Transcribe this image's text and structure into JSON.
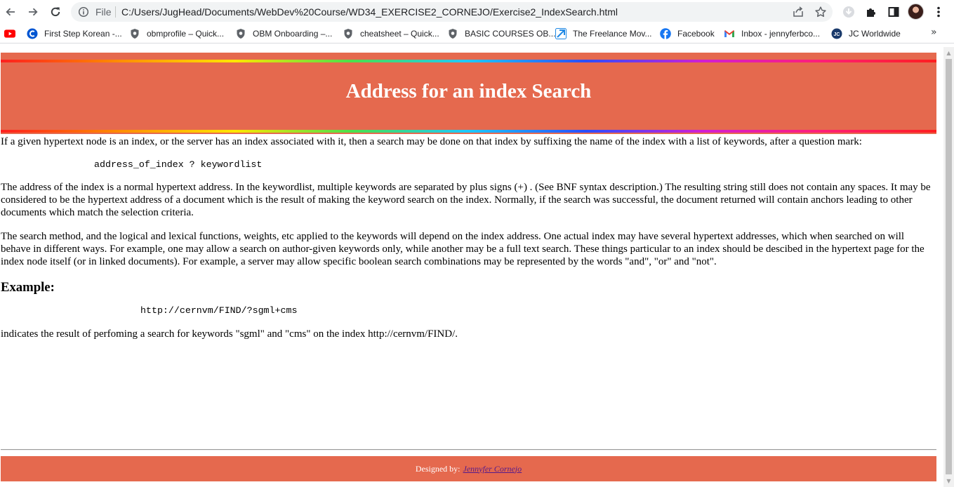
{
  "browser": {
    "omnibox": {
      "scheme_label": "File",
      "url": "C:/Users/JugHead/Documents/WebDev%20Course/WD34_EXERCISE2_CORNEJO/Exercise2_IndexSearch.html"
    },
    "icons": {
      "back": "back-arrow-icon",
      "forward": "forward-arrow-icon",
      "reload": "reload-icon",
      "info": "info-icon",
      "share": "share-icon",
      "bookmark": "star-icon",
      "download": "download-icon",
      "extensions": "puzzle-icon",
      "side_panel": "side-panel-icon",
      "menu": "kebab-menu-icon"
    },
    "bookmarks": [
      {
        "label": "",
        "icon": "youtube-icon",
        "color": "#ff0000"
      },
      {
        "label": "First Step Korean -...",
        "icon": "coursera-icon",
        "color": "#0056d2"
      },
      {
        "label": "obmprofile – Quick...",
        "icon": "shield-icon",
        "color": "#5f6368"
      },
      {
        "label": "OBM Onboarding –...",
        "icon": "shield-icon",
        "color": "#5f6368"
      },
      {
        "label": "cheatsheet – Quick...",
        "icon": "shield-icon",
        "color": "#5f6368"
      },
      {
        "label": "BASIC COURSES OB...",
        "icon": "shield-icon",
        "color": "#5f6368"
      },
      {
        "label": "The Freelance Mov...",
        "icon": "freelance-icon",
        "color": "#1e88e5"
      },
      {
        "label": "Facebook",
        "icon": "facebook-icon",
        "color": "#1877f2"
      },
      {
        "label": "Inbox - jennyferbco...",
        "icon": "gmail-icon",
        "color": "#ea4335"
      },
      {
        "label": "JC Worldwide",
        "icon": "jc-icon",
        "color": "#1a3a6b"
      }
    ],
    "bookmarks_more": "»"
  },
  "page": {
    "title": "Address for an index Search",
    "p1": "If a given hypertext node is an index, or the server has an index associated with it, then a search may be done on that index by suffixing the name of the index with a list of keywords, after a question mark:",
    "code1": "address_of_index ? keywordlist",
    "p2": "The address of the index is a normal hypertext address. In the keywordlist, multiple keywords are separated by plus signs (+) . (See BNF syntax description.) The resulting string still does not contain any spaces. It may be considered to be the hypertext address of a document which is the result of making the keyword search on the index. Normally, if the search was successful, the document returned will contain anchors leading to other documents which match the selection criteria.",
    "p3": "The search method, and the logical and lexical functions, weights, etc applied to the keywords will depend on the index address. One actual index may have several hypertext addresses, which when searched on will behave in different ways. For example, one may allow a search on author-given keywords only, while another may be a full text search. These things particular to an index should be descibed in the hypertext page for the index node itself (or in linked documents). For example, a server may allow specific boolean search combinations may be represented by the words \"and\", \"or\" and \"not\".",
    "example_heading": "Example:",
    "code2": "http://cernvm/FIND/?sgml+cms",
    "p4": "indicates the result of perfoming a search for keywords \"sgml\" and \"cms\" on the index http://cernvm/FIND/.",
    "footer_label": "Designed by:",
    "footer_link": "Jennyfer Cornejo"
  },
  "colors": {
    "header_bg": "#e5694e",
    "footer_bg": "#e5694e",
    "link": "#551a8b"
  }
}
